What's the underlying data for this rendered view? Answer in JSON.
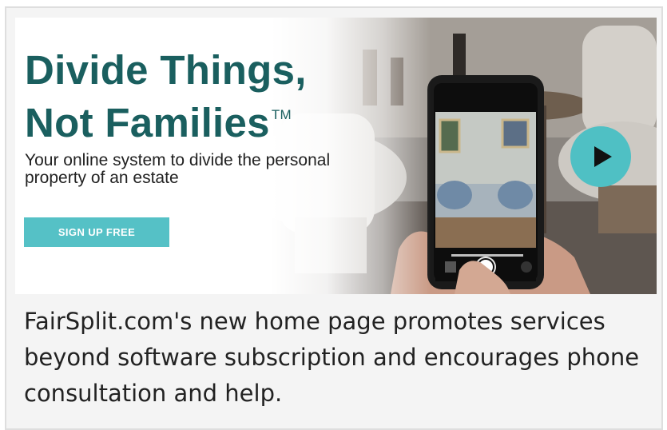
{
  "banner": {
    "headline_line1": "Divide Things,",
    "headline_line2": "Not Families",
    "trademark": "TM",
    "subtitle": "Your online system to divide the personal property of an estate",
    "signup_label": "SIGN UP FREE",
    "play_icon": "play-icon",
    "colors": {
      "headline": "#1a5f5f",
      "button": "#55c1c6",
      "play": "#4fc0c4"
    }
  },
  "caption": {
    "text": "FairSplit.com's new home page promotes services beyond software subscription and encourages phone consultation and help."
  }
}
